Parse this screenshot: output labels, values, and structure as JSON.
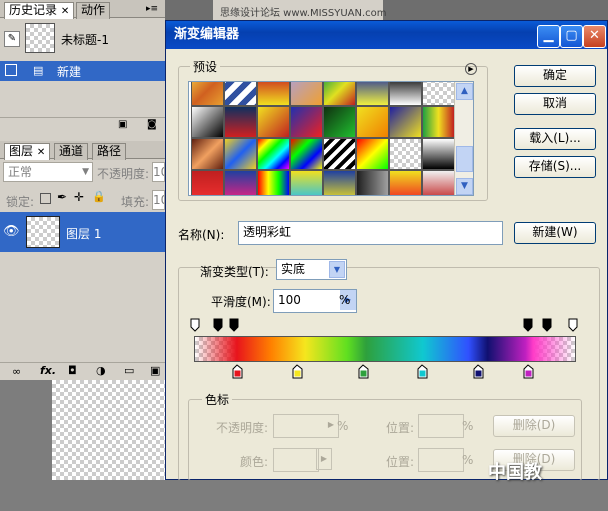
{
  "watermark_top": "思缘设计论坛 www.MISSYUAN.com",
  "watermark_bottom": "中国教",
  "history_panel": {
    "tabs": [
      "历史记录",
      "动作"
    ],
    "snapshot_label": "未标题-1",
    "items": [
      "新建"
    ]
  },
  "layers_panel": {
    "tabs": [
      "图层",
      "通道",
      "路径"
    ],
    "blend_mode": "正常",
    "opacity_label": "不透明度:",
    "opacity_value": "10",
    "lock_label": "锁定:",
    "fill_label": "填充:",
    "fill_value": "10",
    "layer_name": "图层 1"
  },
  "dialog": {
    "title": "渐变编辑器",
    "presets_label": "预设",
    "buttons": {
      "ok": "确定",
      "cancel": "取消",
      "load": "载入(L)...",
      "save": "存储(S)...",
      "new": "新建(W)"
    },
    "name_label": "名称(N):",
    "name_value": "透明彩虹",
    "gradient_type_label": "渐变类型(T):",
    "gradient_type_value": "实底",
    "smoothness_label": "平滑度(M):",
    "smoothness_value": "100",
    "percent": "%",
    "stops_group": "色标",
    "opacity_label": "不透明度:",
    "position_label": "位置:",
    "color_label": "颜色:",
    "delete_label": "删除(D)",
    "color_stops": [
      "#e8141c",
      "#f5e61e",
      "#2ea03c",
      "#10c8d0",
      "#101070",
      "#c020c0"
    ],
    "colors": {
      "title_bar": "#0a4ac6",
      "dialog_bg": "#ece9d8",
      "selection": "#3168c6"
    }
  }
}
